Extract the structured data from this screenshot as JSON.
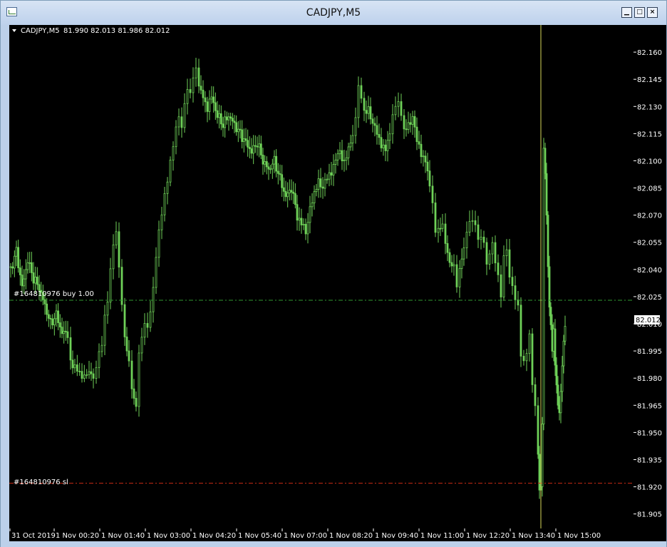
{
  "window": {
    "title": "CADJPY,M5",
    "buttons": [
      "minimize-icon",
      "maximize-icon",
      "close-icon"
    ]
  },
  "chart_header": {
    "symbol": "CADJPY,M5",
    "ohlc": "81.990 82.013 81.986 82.012"
  },
  "order_labels": {
    "open_order": "#164810976 buy 1.00",
    "stop_loss": "#164810976 sl"
  },
  "colors": {
    "background": "#000000",
    "candle": "#6fd158",
    "order_line": "#2f9a2f",
    "stop_line": "#c42a14",
    "cursor_line": "#d8d85a",
    "axis_text": "#ffffff"
  },
  "chart_data": {
    "type": "candlestick",
    "symbol": "CADJPY",
    "timeframe": "M5",
    "last_price": "82.012",
    "order_price": "82.023",
    "stop_loss_price": "81.922",
    "ylim": [
      81.897,
      82.175
    ],
    "y_ticks": [
      "82.160",
      "82.145",
      "82.130",
      "82.115",
      "82.100",
      "82.085",
      "82.070",
      "82.055",
      "82.040",
      "82.025",
      "82.010",
      "81.995",
      "81.980",
      "81.965",
      "81.950",
      "81.935",
      "81.920",
      "81.905"
    ],
    "x_ticks": [
      "31 Oct 2019",
      "1 Nov 00:20",
      "1 Nov 01:40",
      "1 Nov 03:00",
      "1 Nov 04:20",
      "1 Nov 05:40",
      "1 Nov 07:00",
      "1 Nov 08:20",
      "1 Nov 09:40",
      "1 Nov 11:00",
      "1 Nov 12:20",
      "1 Nov 13:40",
      "1 Nov 15:00"
    ],
    "close_path": [
      [
        0,
        82.04
      ],
      [
        8,
        82.05
      ],
      [
        16,
        82.03
      ],
      [
        24,
        82.045
      ],
      [
        32,
        82.035
      ],
      [
        40,
        82.03
      ],
      [
        48,
        82.02
      ],
      [
        56,
        82.01
      ],
      [
        64,
        82.015
      ],
      [
        72,
        82.005
      ],
      [
        80,
        82.005
      ],
      [
        84,
        81.99
      ],
      [
        90,
        81.985
      ],
      [
        100,
        81.98
      ],
      [
        110,
        81.985
      ],
      [
        116,
        81.98
      ],
      [
        120,
        81.985
      ],
      [
        124,
        81.995
      ],
      [
        128,
        82.0
      ],
      [
        132,
        82.015
      ],
      [
        136,
        82.025
      ],
      [
        140,
        82.04
      ],
      [
        144,
        82.055
      ],
      [
        148,
        82.06
      ],
      [
        152,
        82.04
      ],
      [
        156,
        82.02
      ],
      [
        160,
        82.0
      ],
      [
        166,
        81.99
      ],
      [
        170,
        81.975
      ],
      [
        176,
        81.965
      ],
      [
        180,
        81.995
      ],
      [
        184,
        82.005
      ],
      [
        188,
        82.01
      ],
      [
        192,
        82.01
      ],
      [
        196,
        82.015
      ],
      [
        200,
        82.03
      ],
      [
        204,
        82.045
      ],
      [
        208,
        82.06
      ],
      [
        212,
        82.07
      ],
      [
        216,
        82.08
      ],
      [
        220,
        82.09
      ],
      [
        224,
        82.1
      ],
      [
        228,
        82.11
      ],
      [
        232,
        82.12
      ],
      [
        236,
        82.125
      ],
      [
        240,
        82.12
      ],
      [
        244,
        82.13
      ],
      [
        248,
        82.14
      ],
      [
        252,
        82.135
      ],
      [
        256,
        82.145
      ],
      [
        260,
        82.15
      ],
      [
        264,
        82.14
      ],
      [
        270,
        82.135
      ],
      [
        276,
        82.13
      ],
      [
        282,
        82.135
      ],
      [
        290,
        82.125
      ],
      [
        298,
        82.12
      ],
      [
        306,
        82.125
      ],
      [
        314,
        82.12
      ],
      [
        322,
        82.115
      ],
      [
        330,
        82.11
      ],
      [
        338,
        82.105
      ],
      [
        346,
        82.11
      ],
      [
        354,
        82.1
      ],
      [
        362,
        82.095
      ],
      [
        370,
        82.1
      ],
      [
        378,
        82.09
      ],
      [
        386,
        82.08
      ],
      [
        394,
        82.085
      ],
      [
        402,
        82.07
      ],
      [
        408,
        82.065
      ],
      [
        414,
        82.06
      ],
      [
        420,
        82.075
      ],
      [
        426,
        82.08
      ],
      [
        432,
        82.09
      ],
      [
        438,
        82.085
      ],
      [
        444,
        82.09
      ],
      [
        450,
        82.095
      ],
      [
        456,
        82.1
      ],
      [
        462,
        82.105
      ],
      [
        468,
        82.1
      ],
      [
        474,
        82.105
      ],
      [
        480,
        82.115
      ],
      [
        484,
        82.125
      ],
      [
        488,
        82.14
      ],
      [
        492,
        82.135
      ],
      [
        496,
        82.125
      ],
      [
        502,
        82.13
      ],
      [
        508,
        82.12
      ],
      [
        514,
        82.115
      ],
      [
        520,
        82.11
      ],
      [
        526,
        82.105
      ],
      [
        532,
        82.115
      ],
      [
        536,
        82.125
      ],
      [
        540,
        82.13
      ],
      [
        544,
        82.13
      ],
      [
        548,
        82.125
      ],
      [
        552,
        82.115
      ],
      [
        558,
        82.12
      ],
      [
        564,
        82.125
      ],
      [
        570,
        82.11
      ],
      [
        576,
        82.105
      ],
      [
        582,
        82.1
      ],
      [
        588,
        82.085
      ],
      [
        592,
        82.075
      ],
      [
        596,
        82.06
      ],
      [
        600,
        82.06
      ],
      [
        606,
        82.065
      ],
      [
        610,
        82.055
      ],
      [
        616,
        82.045
      ],
      [
        622,
        82.04
      ],
      [
        626,
        82.03
      ],
      [
        630,
        82.04
      ],
      [
        636,
        82.05
      ],
      [
        640,
        82.06
      ],
      [
        644,
        82.065
      ],
      [
        648,
        82.065
      ],
      [
        652,
        82.065
      ],
      [
        656,
        82.055
      ],
      [
        660,
        82.06
      ],
      [
        664,
        82.055
      ],
      [
        668,
        82.045
      ],
      [
        672,
        82.05
      ],
      [
        676,
        82.055
      ],
      [
        680,
        82.045
      ],
      [
        684,
        82.035
      ],
      [
        688,
        82.025
      ],
      [
        692,
        82.045
      ],
      [
        696,
        82.05
      ],
      [
        700,
        82.035
      ],
      [
        704,
        82.03
      ],
      [
        708,
        82.025
      ],
      [
        712,
        82.02
      ],
      [
        716,
        81.995
      ],
      [
        720,
        81.99
      ],
      [
        724,
        81.995
      ],
      [
        728,
        82.005
      ],
      [
        732,
        81.975
      ],
      [
        736,
        81.965
      ],
      [
        740,
        81.935
      ],
      [
        742,
        81.92
      ],
      [
        744,
        81.92
      ],
      [
        746,
        81.955
      ],
      [
        748,
        82.105
      ],
      [
        750,
        82.095
      ],
      [
        752,
        82.07
      ],
      [
        754,
        82.04
      ],
      [
        756,
        82.02
      ],
      [
        758,
        82.01
      ],
      [
        760,
        81.995
      ],
      [
        762,
        82.005
      ],
      [
        764,
        81.99
      ],
      [
        766,
        81.975
      ],
      [
        768,
        81.965
      ],
      [
        770,
        81.96
      ],
      [
        772,
        81.975
      ],
      [
        774,
        81.985
      ],
      [
        776,
        82.0
      ],
      [
        778,
        82.01
      ],
      [
        780,
        81.995
      ]
    ]
  }
}
